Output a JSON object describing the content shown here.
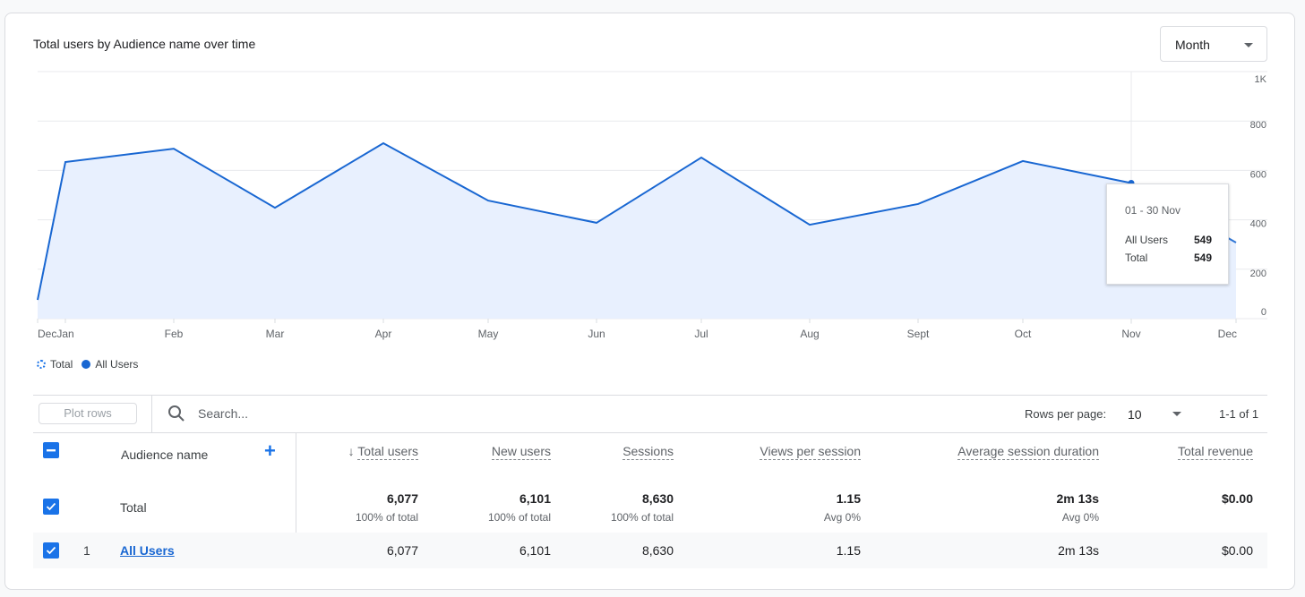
{
  "card": {
    "title": "Total users by Audience name over time",
    "period_select": {
      "value": "Month"
    }
  },
  "chart_data": {
    "type": "area",
    "title": "Total users by Audience name over time",
    "x": [
      "Dec",
      "Jan",
      "Feb",
      "Mar",
      "Apr",
      "May",
      "Jun",
      "Jul",
      "Aug",
      "Sept",
      "Oct",
      "Nov",
      "Dec"
    ],
    "series": [
      {
        "name": "All Users",
        "values": [
          76,
          634,
          688,
          449,
          710,
          478,
          388,
          652,
          380,
          464,
          638,
          549,
          308
        ],
        "color": "#1967d2",
        "fill": "#e8f0fe"
      }
    ],
    "y_ticks": [
      "0",
      "200",
      "400",
      "600",
      "800",
      "1K"
    ],
    "y_tick_values": [
      0,
      200,
      400,
      600,
      800,
      1000
    ],
    "ylim": [
      0,
      1000
    ],
    "xlabel": "",
    "ylabel": "",
    "grid": true,
    "y_axis_side": "right",
    "legend": {
      "placement": "bottom-left",
      "entries": [
        {
          "name": "Total",
          "style": "dotted"
        },
        {
          "name": "All Users",
          "style": "filled"
        }
      ]
    },
    "tooltip": {
      "index": 11,
      "date": "01 - 30 Nov",
      "rows": [
        {
          "label": "All Users",
          "value": "549"
        },
        {
          "label": "Total",
          "value": "549"
        }
      ]
    }
  },
  "toolbar": {
    "plot_rows": "Plot rows",
    "search_placeholder": "Search...",
    "rows_per_page_label": "Rows per page:",
    "rows_per_page_value": "10",
    "pagination": "1-1 of 1"
  },
  "table": {
    "dimension_header": "Audience name",
    "columns": [
      {
        "label": "Total users",
        "sorted": "desc"
      },
      {
        "label": "New users"
      },
      {
        "label": "Sessions"
      },
      {
        "label": "Views per session"
      },
      {
        "label": "Average session duration"
      },
      {
        "label": "Total revenue"
      }
    ],
    "total_row": {
      "label": "Total",
      "values": [
        "6,077",
        "6,101",
        "8,630",
        "1.15",
        "2m 13s",
        "$0.00"
      ],
      "subs": [
        "100% of total",
        "100% of total",
        "100% of total",
        "Avg 0%",
        "Avg 0%",
        ""
      ]
    },
    "rows": [
      {
        "index": "1",
        "name": "All Users",
        "values": [
          "6,077",
          "6,101",
          "8,630",
          "1.15",
          "2m 13s",
          "$0.00"
        ]
      }
    ]
  },
  "colors": {
    "accent": "#1a73e8",
    "line": "#1967d2",
    "area": "#e8f0fe"
  }
}
